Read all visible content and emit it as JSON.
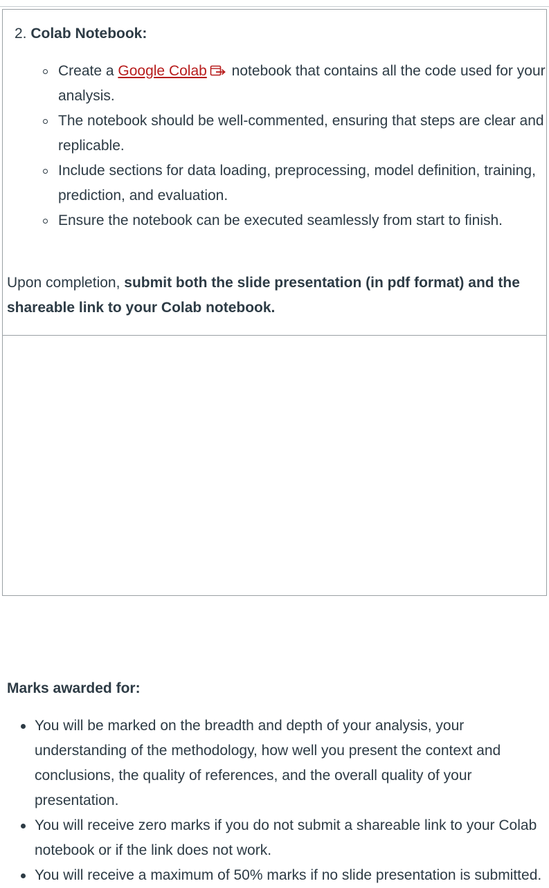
{
  "section": {
    "number": "2.",
    "title": "Colab Notebook:"
  },
  "items": [
    {
      "prefix": "Create a ",
      "link_text": "Google Colab",
      "link_icon": "external-link-icon",
      "suffix": " notebook that contains all the code used for your analysis."
    },
    {
      "text": "The notebook should be well-commented, ensuring that steps are clear and replicable."
    },
    {
      "text": "Include sections for data loading, preprocessing, model definition, training, prediction, and evaluation."
    },
    {
      "text": "Ensure the notebook can be executed seamlessly from start to finish."
    }
  ],
  "completion": {
    "prefix": "Upon completion, ",
    "bold": "submit both the slide presentation (in pdf format) and the shareable link to your Colab notebook."
  },
  "marks": {
    "heading": "Marks awarded for:",
    "items": [
      "You will be marked on the breadth and depth of your analysis, your understanding of the methodology, how well you present the context and conclusions, the quality of references, and the overall quality of your presentation.",
      "You will receive zero marks if you do not submit a shareable link to your Colab notebook or if the link does not work.",
      "You will receive a maximum of 50% marks if no slide presentation is submitted."
    ]
  },
  "colors": {
    "text": "#2d3b45",
    "link": "#b71c1c",
    "border": "#9aa0a4"
  }
}
